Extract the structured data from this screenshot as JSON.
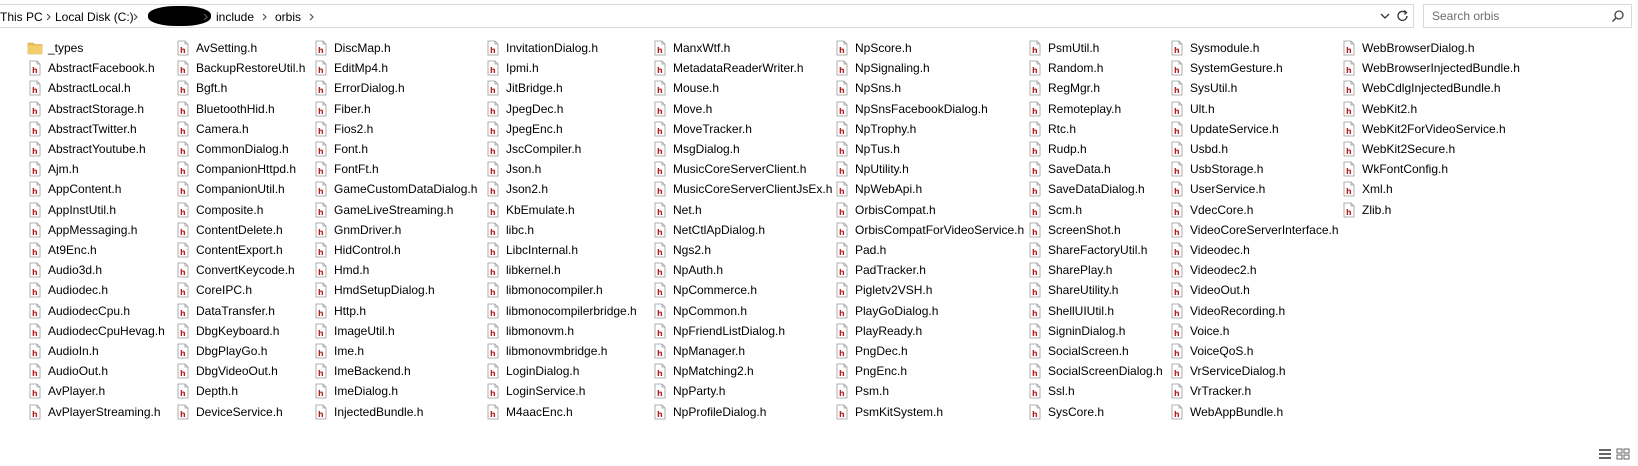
{
  "breadcrumb": {
    "items": [
      "This PC",
      "Local Disk (C:)",
      "include",
      "orbis"
    ]
  },
  "search": {
    "placeholder": "Search orbis"
  },
  "icons": {
    "folder": "folder-icon",
    "header_file": "h-file-icon",
    "search": "search-icon",
    "refresh": "refresh-icon",
    "dropdown": "chevron-down-icon"
  },
  "colors": {
    "folder": "#e8bd55",
    "h_file": "#b22222",
    "border": "#d9d9d9"
  },
  "columns": [
    [
      "_types",
      "AbstractFacebook.h",
      "AbstractLocal.h",
      "AbstractStorage.h",
      "AbstractTwitter.h",
      "AbstractYoutube.h",
      "Ajm.h",
      "AppContent.h",
      "AppInstUtil.h",
      "AppMessaging.h",
      "At9Enc.h",
      "Audio3d.h",
      "Audiodec.h",
      "AudiodecCpu.h",
      "AudiodecCpuHevag.h",
      "AudioIn.h",
      "AudioOut.h",
      "AvPlayer.h",
      "AvPlayerStreaming.h"
    ],
    [
      "AvSetting.h",
      "BackupRestoreUtil.h",
      "Bgft.h",
      "BluetoothHid.h",
      "Camera.h",
      "CommonDialog.h",
      "CompanionHttpd.h",
      "CompanionUtil.h",
      "Composite.h",
      "ContentDelete.h",
      "ContentExport.h",
      "ConvertKeycode.h",
      "CoreIPC.h",
      "DataTransfer.h",
      "DbgKeyboard.h",
      "DbgPlayGo.h",
      "DbgVideoOut.h",
      "Depth.h",
      "DeviceService.h"
    ],
    [
      "DiscMap.h",
      "EditMp4.h",
      "ErrorDialog.h",
      "Fiber.h",
      "Fios2.h",
      "Font.h",
      "FontFt.h",
      "GameCustomDataDialog.h",
      "GameLiveStreaming.h",
      "GnmDriver.h",
      "HidControl.h",
      "Hmd.h",
      "HmdSetupDialog.h",
      "Http.h",
      "ImageUtil.h",
      "Ime.h",
      "ImeBackend.h",
      "ImeDialog.h",
      "InjectedBundle.h"
    ],
    [
      "InvitationDialog.h",
      "Ipmi.h",
      "JitBridge.h",
      "JpegDec.h",
      "JpegEnc.h",
      "JscCompiler.h",
      "Json.h",
      "Json2.h",
      "KbEmulate.h",
      "libc.h",
      "LibcInternal.h",
      "libkernel.h",
      "libmonocompiler.h",
      "libmonocompilerbridge.h",
      "libmonovm.h",
      "libmonovmbridge.h",
      "LoginDialog.h",
      "LoginService.h",
      "M4aacEnc.h"
    ],
    [
      "ManxWtf.h",
      "MetadataReaderWriter.h",
      "Mouse.h",
      "Move.h",
      "MoveTracker.h",
      "MsgDialog.h",
      "MusicCoreServerClient.h",
      "MusicCoreServerClientJsEx.h",
      "Net.h",
      "NetCtlApDialog.h",
      "Ngs2.h",
      "NpAuth.h",
      "NpCommerce.h",
      "NpCommon.h",
      "NpFriendListDialog.h",
      "NpManager.h",
      "NpMatching2.h",
      "NpParty.h",
      "NpProfileDialog.h"
    ],
    [
      "NpScore.h",
      "NpSignaling.h",
      "NpSns.h",
      "NpSnsFacebookDialog.h",
      "NpTrophy.h",
      "NpTus.h",
      "NpUtility.h",
      "NpWebApi.h",
      "OrbisCompat.h",
      "OrbisCompatForVideoService.h",
      "Pad.h",
      "PadTracker.h",
      "Pigletv2VSH.h",
      "PlayGoDialog.h",
      "PlayReady.h",
      "PngDec.h",
      "PngEnc.h",
      "Psm.h",
      "PsmKitSystem.h"
    ],
    [
      "PsmUtil.h",
      "Random.h",
      "RegMgr.h",
      "Remoteplay.h",
      "Rtc.h",
      "Rudp.h",
      "SaveData.h",
      "SaveDataDialog.h",
      "Scm.h",
      "ScreenShot.h",
      "ShareFactoryUtil.h",
      "SharePlay.h",
      "ShareUtility.h",
      "ShellUIUtil.h",
      "SigninDialog.h",
      "SocialScreen.h",
      "SocialScreenDialog.h",
      "Ssl.h",
      "SysCore.h"
    ],
    [
      "Sysmodule.h",
      "SystemGesture.h",
      "SysUtil.h",
      "Ult.h",
      "UpdateService.h",
      "Usbd.h",
      "UsbStorage.h",
      "UserService.h",
      "VdecCore.h",
      "VideoCoreServerInterface.h",
      "Videodec.h",
      "Videodec2.h",
      "VideoOut.h",
      "VideoRecording.h",
      "Voice.h",
      "VoiceQoS.h",
      "VrServiceDialog.h",
      "VrTracker.h",
      "WebAppBundle.h"
    ],
    [
      "WebBrowserDialog.h",
      "WebBrowserInjectedBundle.h",
      "WebCdlgInjectedBundle.h",
      "WebKit2.h",
      "WebKit2ForVideoService.h",
      "WebKit2Secure.h",
      "WkFontConfig.h",
      "Xml.h",
      "Zlib.h"
    ]
  ]
}
